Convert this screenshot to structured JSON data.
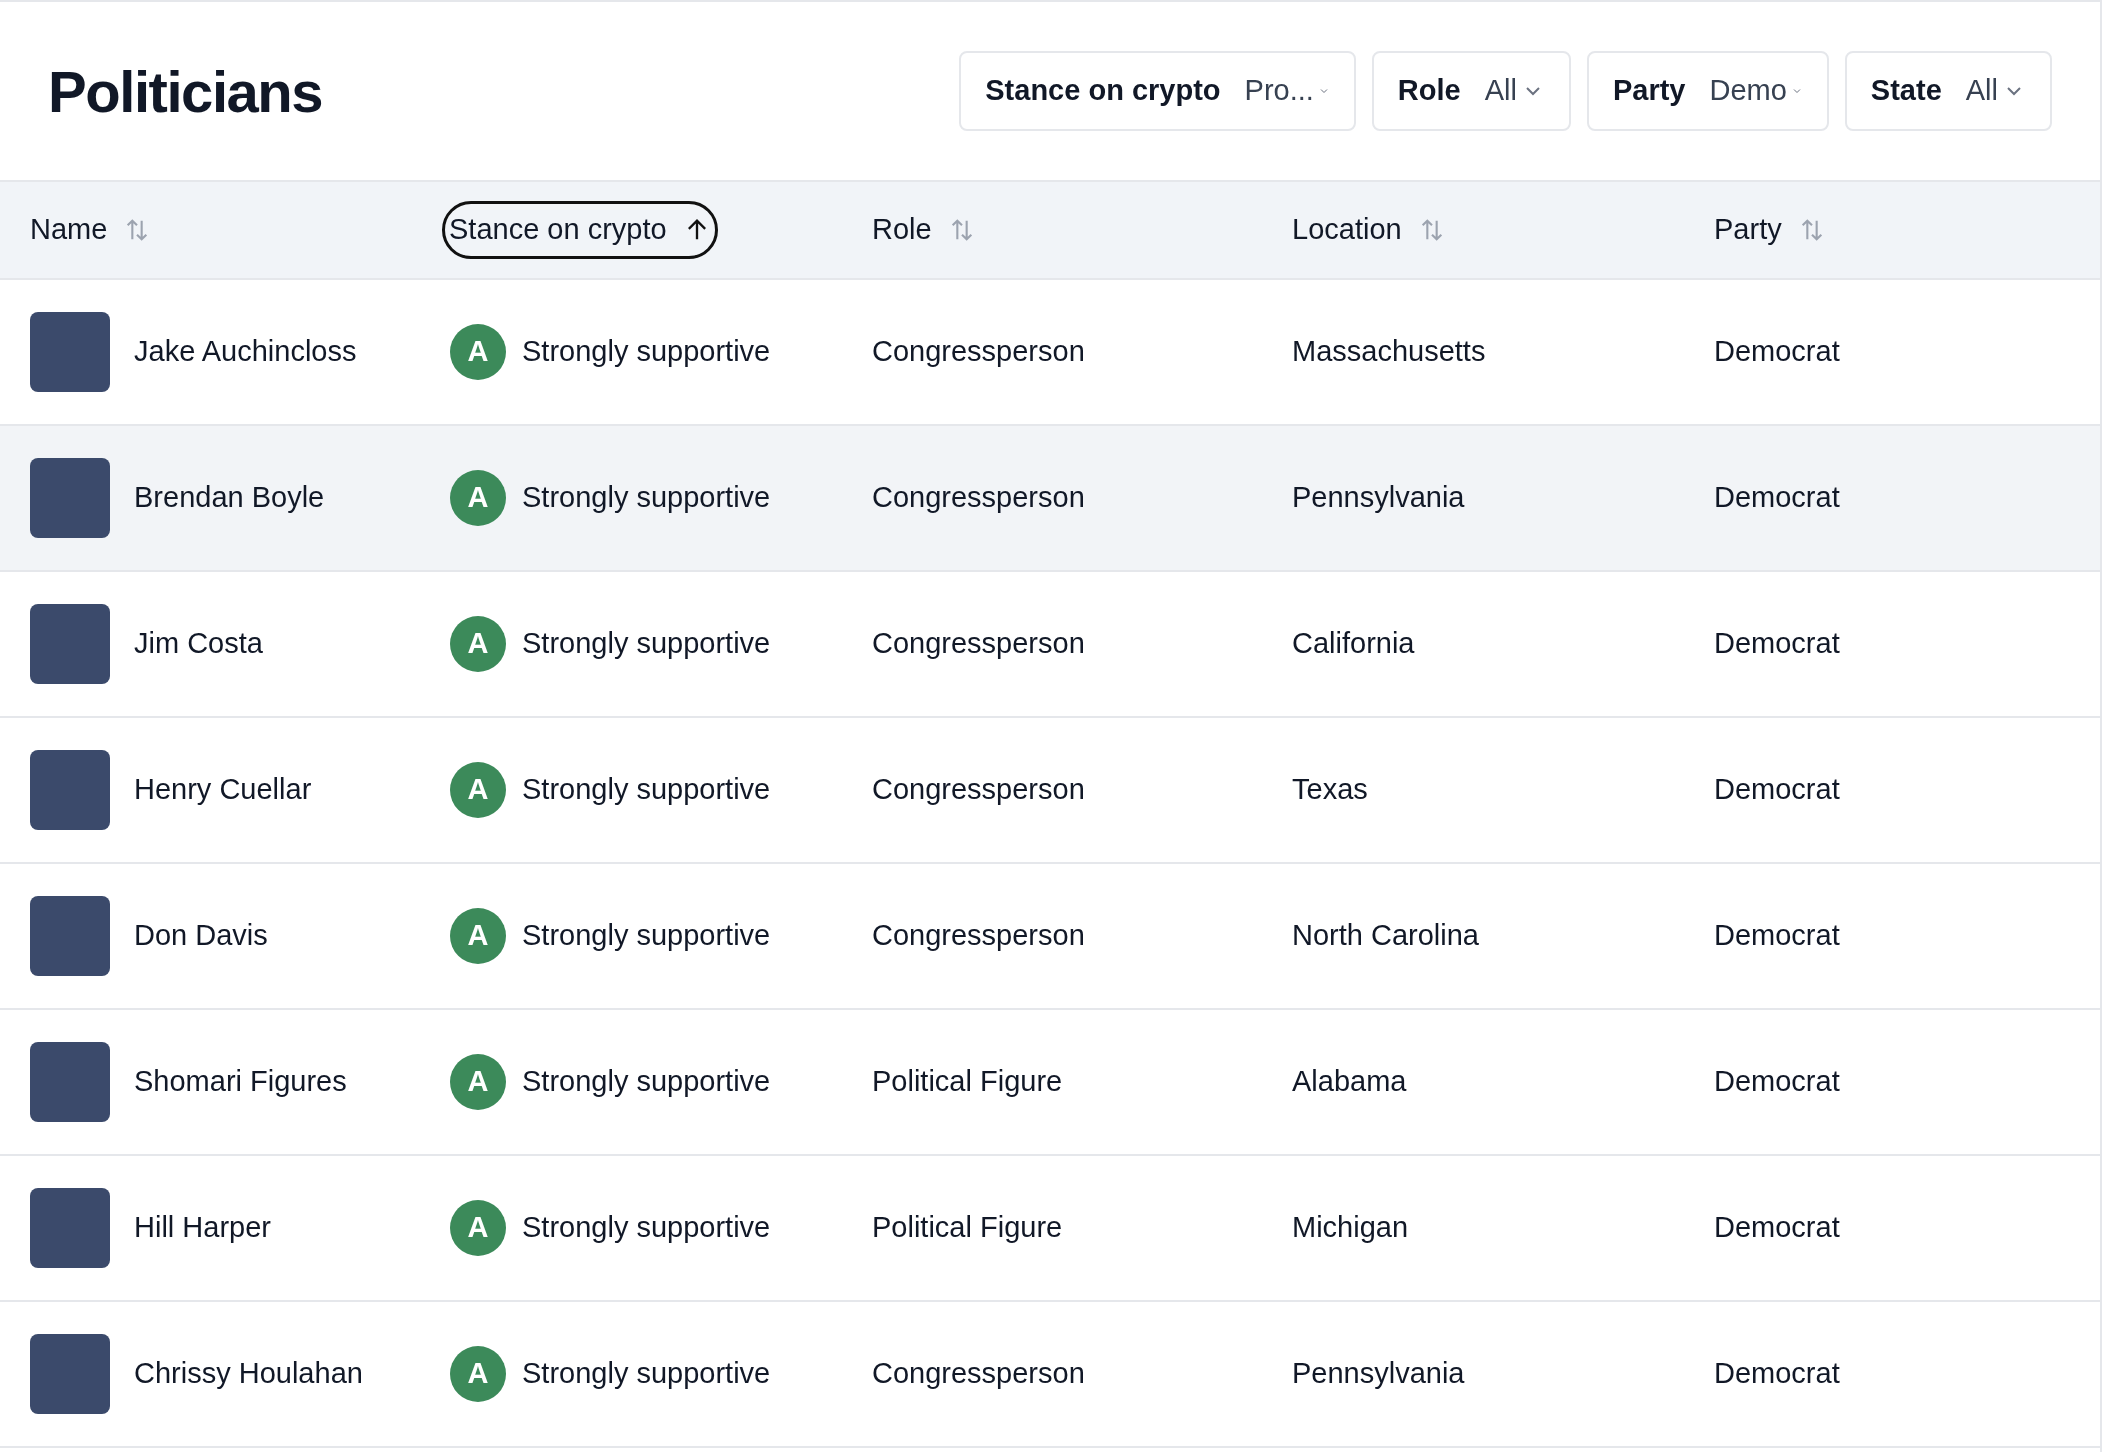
{
  "title": "Politicians",
  "filters": [
    {
      "label": "Stance on crypto",
      "value": "Pro..."
    },
    {
      "label": "Role",
      "value": "All"
    },
    {
      "label": "Party",
      "value": "Demo"
    },
    {
      "label": "State",
      "value": "All"
    }
  ],
  "table": {
    "columns": [
      {
        "label": "Name",
        "sorted": false,
        "focused": false
      },
      {
        "label": "Stance on crypto",
        "sorted": true,
        "focused": true
      },
      {
        "label": "Role",
        "sorted": false,
        "focused": false
      },
      {
        "label": "Location",
        "sorted": false,
        "focused": false
      },
      {
        "label": "Party",
        "sorted": false,
        "focused": false
      }
    ],
    "rows": [
      {
        "name": "Jake Auchincloss",
        "grade": "A",
        "stance": "Strongly supportive",
        "role": "Congressperson",
        "location": "Massachusetts",
        "party": "Democrat",
        "highlighted": false
      },
      {
        "name": "Brendan Boyle",
        "grade": "A",
        "stance": "Strongly supportive",
        "role": "Congressperson",
        "location": "Pennsylvania",
        "party": "Democrat",
        "highlighted": true
      },
      {
        "name": "Jim Costa",
        "grade": "A",
        "stance": "Strongly supportive",
        "role": "Congressperson",
        "location": "California",
        "party": "Democrat",
        "highlighted": false
      },
      {
        "name": "Henry Cuellar",
        "grade": "A",
        "stance": "Strongly supportive",
        "role": "Congressperson",
        "location": "Texas",
        "party": "Democrat",
        "highlighted": false
      },
      {
        "name": "Don Davis",
        "grade": "A",
        "stance": "Strongly supportive",
        "role": "Congressperson",
        "location": "North Carolina",
        "party": "Democrat",
        "highlighted": false
      },
      {
        "name": "Shomari Figures",
        "grade": "A",
        "stance": "Strongly supportive",
        "role": "Political Figure",
        "location": "Alabama",
        "party": "Democrat",
        "highlighted": false
      },
      {
        "name": "Hill Harper",
        "grade": "A",
        "stance": "Strongly supportive",
        "role": "Political Figure",
        "location": "Michigan",
        "party": "Democrat",
        "highlighted": false
      },
      {
        "name": "Chrissy Houlahan",
        "grade": "A",
        "stance": "Strongly supportive",
        "role": "Congressperson",
        "location": "Pennsylvania",
        "party": "Democrat",
        "highlighted": false
      }
    ]
  }
}
